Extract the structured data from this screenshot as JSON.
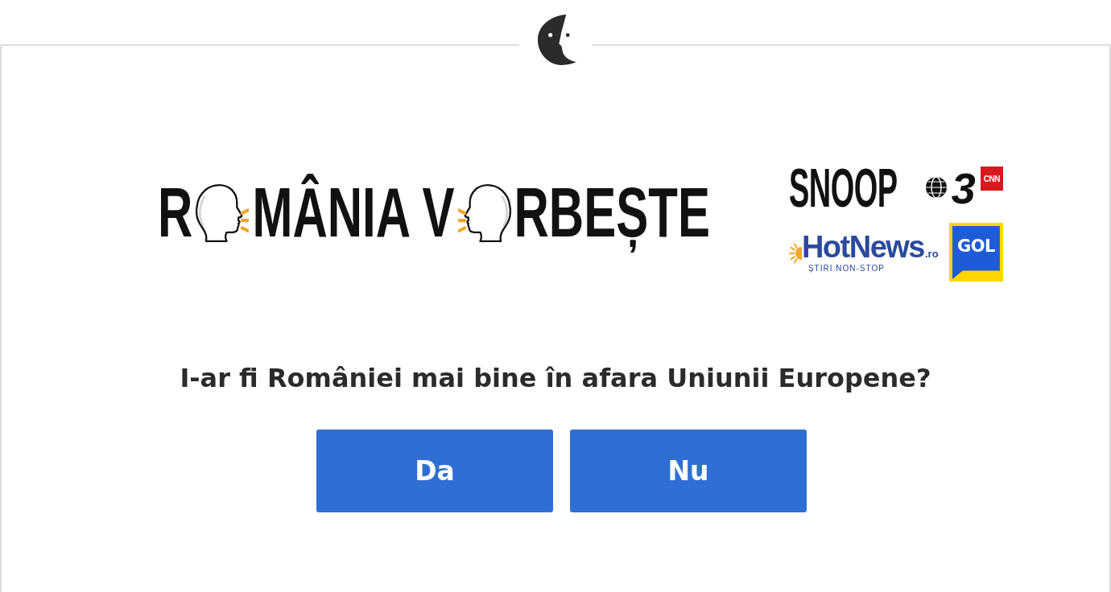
{
  "campaign_logo": {
    "parts": [
      "R",
      "MÂNIA V",
      "RBEȘTE"
    ]
  },
  "partners": [
    {
      "kind": "snoop",
      "name": "SNOOP"
    },
    {
      "kind": "antena",
      "name": "3",
      "badge": "CNN"
    },
    {
      "kind": "hotnews",
      "name": "HotNews",
      "suffix": ".ro",
      "tagline": "ȘTIRI NON-STOP"
    },
    {
      "kind": "gol",
      "name": "GOL"
    }
  ],
  "question": "I-ar fi României mai bine în afara Uniunii Europene?",
  "answers": [
    "Da",
    "Nu"
  ]
}
